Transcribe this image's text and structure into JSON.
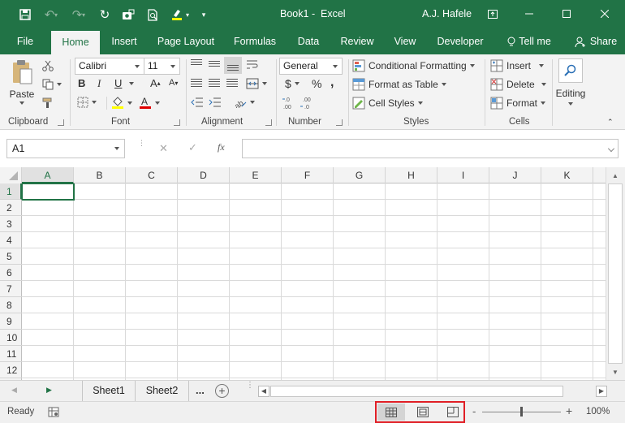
{
  "window": {
    "doc_title": "Book1",
    "separator": "-",
    "app_name": "Excel",
    "user": "A.J. Hafele"
  },
  "tabs": {
    "file": "File",
    "home": "Home",
    "insert": "Insert",
    "page_layout": "Page Layout",
    "formulas": "Formulas",
    "data": "Data",
    "review": "Review",
    "view": "View",
    "developer": "Developer",
    "tell_me": "Tell me",
    "share": "Share"
  },
  "ribbon": {
    "clipboard": {
      "paste": "Paste",
      "label": "Clipboard"
    },
    "font": {
      "name": "Calibri",
      "size": "11",
      "bold": "B",
      "italic": "I",
      "underline": "U",
      "grow": "A",
      "shrink": "A",
      "label": "Font"
    },
    "alignment": {
      "label": "Alignment"
    },
    "number": {
      "format": "General",
      "currency": "$",
      "percent": "%",
      "comma": ",",
      "inc": ".0→.00",
      "dec": ".00→.0",
      "label": "Number"
    },
    "styles": {
      "conditional": "Conditional Formatting",
      "table": "Format as Table",
      "cell": "Cell Styles",
      "label": "Styles"
    },
    "cells": {
      "insert": "Insert",
      "delete": "Delete",
      "format": "Format",
      "label": "Cells"
    },
    "editing": {
      "label": "Editing"
    }
  },
  "formula_bar": {
    "name_box": "A1",
    "cancel": "✕",
    "enter": "✓",
    "fx": "fx",
    "content": ""
  },
  "grid": {
    "columns": [
      "A",
      "B",
      "C",
      "D",
      "E",
      "F",
      "G",
      "H",
      "I",
      "J",
      "K"
    ],
    "rows": [
      "1",
      "2",
      "3",
      "4",
      "5",
      "6",
      "7",
      "8",
      "9",
      "10",
      "11",
      "12"
    ]
  },
  "sheets": {
    "tabs": [
      "Sheet1",
      "Sheet2"
    ],
    "more": "...",
    "add": "+"
  },
  "status": {
    "ready": "Ready",
    "zoom": "100%",
    "minus": "-",
    "plus": "+"
  },
  "colors": {
    "brand": "#217346",
    "highlight_box": "#e01f26",
    "font_color": "#e00000",
    "fill_color": "#ffff00"
  }
}
